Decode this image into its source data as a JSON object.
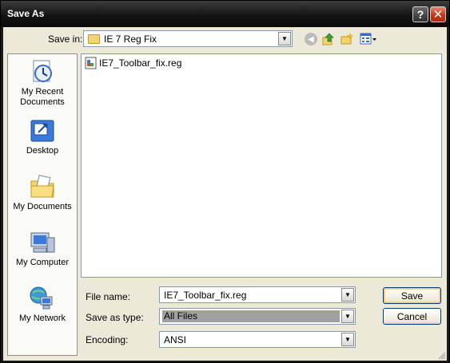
{
  "window": {
    "title": "Save As"
  },
  "titlebar": {
    "help_label": "?",
    "close_label": "✕"
  },
  "top": {
    "save_in_label": "Save in:",
    "save_in_value": "IE 7 Reg Fix",
    "icons": [
      "back-icon",
      "up-folder-icon",
      "new-folder-icon",
      "views-icon"
    ]
  },
  "places": [
    {
      "label": "My Recent Documents",
      "icon": "recent-documents-icon"
    },
    {
      "label": "Desktop",
      "icon": "desktop-icon"
    },
    {
      "label": "My Documents",
      "icon": "my-documents-icon"
    },
    {
      "label": "My Computer",
      "icon": "my-computer-icon"
    },
    {
      "label": "My Network",
      "icon": "my-network-icon"
    }
  ],
  "files": [
    {
      "name": "IE7_Toolbar_fix.reg",
      "icon": "registry-file-icon"
    }
  ],
  "fields": {
    "file_name_label": "File name:",
    "file_name_value": "IE7_Toolbar_fix.reg",
    "save_type_label": "Save as type:",
    "save_type_value": "All Files",
    "encoding_label": "Encoding:",
    "encoding_value": "ANSI"
  },
  "buttons": {
    "save": "Save",
    "cancel": "Cancel"
  },
  "colors": {
    "titlebar": "#141414",
    "client": "#ece9d8",
    "close": "#c2381a",
    "border": "#7f9db9"
  }
}
